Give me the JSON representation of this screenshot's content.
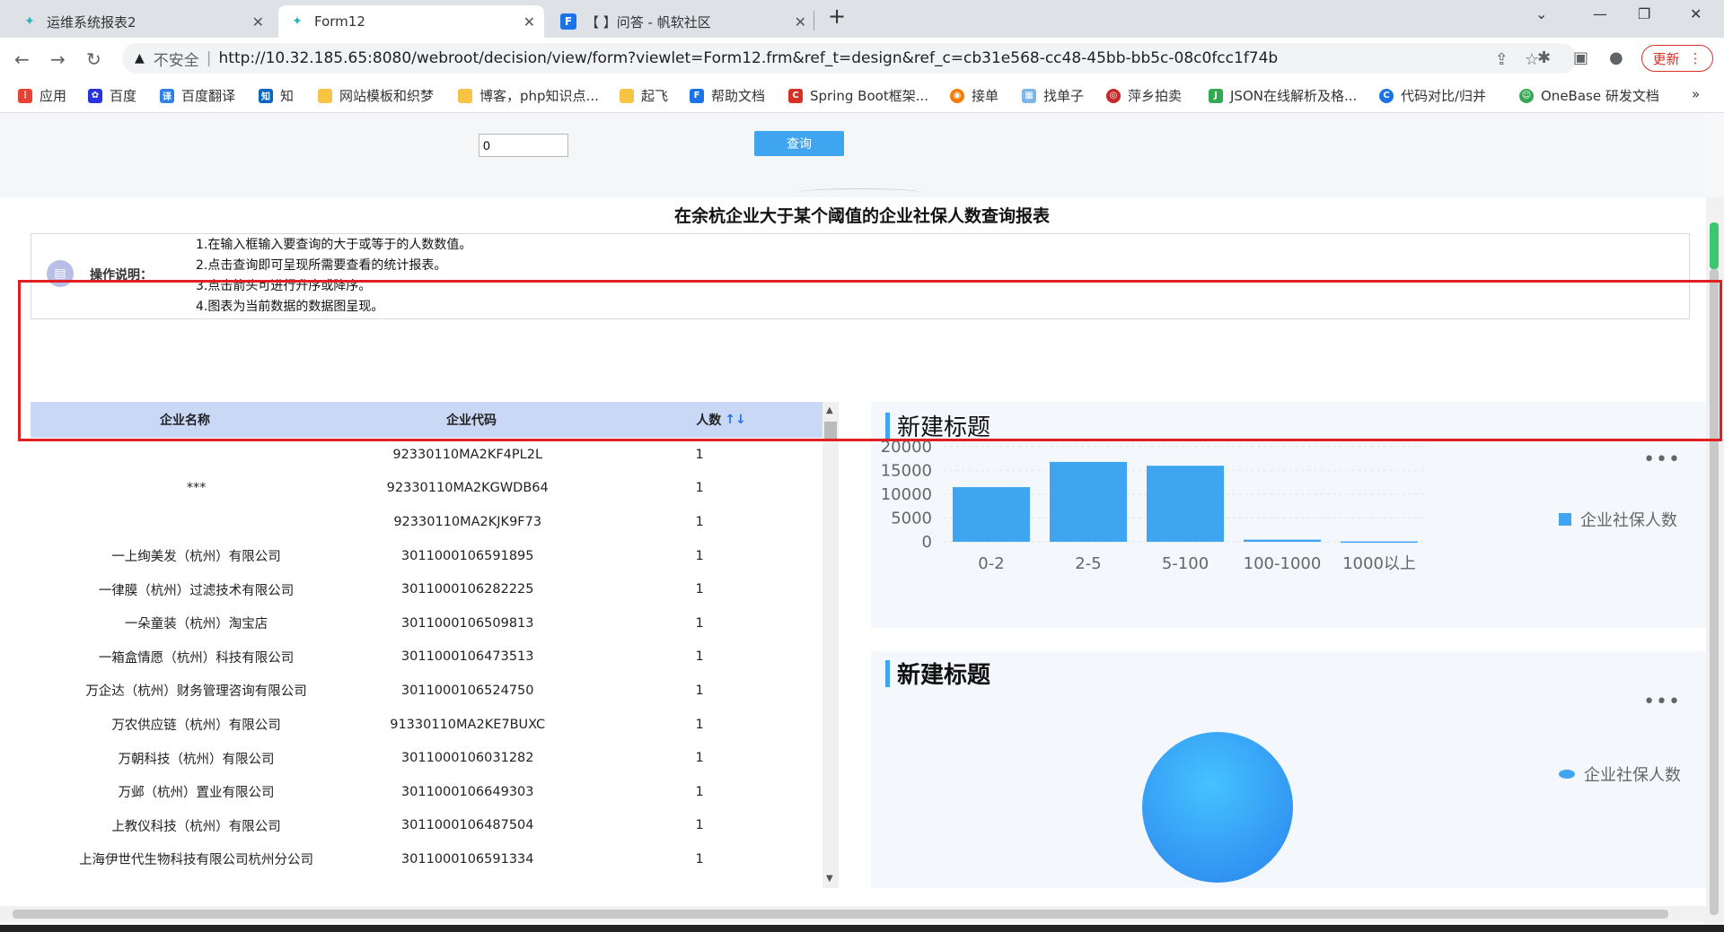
{
  "browser": {
    "tabs": [
      {
        "title": "运维系统报表2",
        "icon": "fanruan-icon"
      },
      {
        "title": "Form12",
        "icon": "fanruan-icon"
      },
      {
        "title": "【              】问答 - 帆软社区",
        "icon": "fanruan-community-icon"
      }
    ],
    "security_label": "不安全",
    "url": "http://10.32.185.65:8080/webroot/decision/view/form?viewlet=Form12.frm&ref_t=design&ref_c=cb31e568-cc48-45bb-bb5c-08c0fcc1f74b",
    "update_label": "更新",
    "bookmarks": [
      "应用",
      "百度",
      "百度翻译",
      "知",
      "网站模板和织梦",
      "博客，php知识点...",
      "起飞",
      "帮助文档",
      "Spring Boot框架...",
      "接单",
      "找单子",
      "萍乡拍卖",
      "JSON在线解析及格...",
      "代码对比/归并",
      "OneBase 研发文档"
    ]
  },
  "query": {
    "input_value": "0",
    "button_label": "查询"
  },
  "report": {
    "title": "在余杭企业大于某个阈值的企业社保人数查询报表",
    "note_label": "操作说明：",
    "notes": [
      "1.在输入框输入要查询的大于或等于的人数数值。",
      "2.点击查询即可呈现所需要查看的统计报表。",
      "3.点击箭头可进行升序或降序。",
      "4.图表为当前数据的数据图呈现。"
    ]
  },
  "table": {
    "headers": [
      "企业名称",
      "企业代码",
      "人数"
    ],
    "sort_icon": "↑↓",
    "rows": [
      [
        "",
        "92330110MA2KF4PL2L",
        "1"
      ],
      [
        "***",
        "92330110MA2KGWDB64",
        "1"
      ],
      [
        "",
        "92330110MA2KJK9F73",
        "1"
      ],
      [
        "一上绚美发（杭州）有限公司",
        "3011000106591895",
        "1"
      ],
      [
        "一律膜（杭州）过滤技术有限公司",
        "3011000106282225",
        "1"
      ],
      [
        "一朵童装（杭州）淘宝店",
        "3011000106509813",
        "1"
      ],
      [
        "一箱盒情愿（杭州）科技有限公司",
        "3011000106473513",
        "1"
      ],
      [
        "万企达（杭州）财务管理咨询有限公司",
        "3011000106524750",
        "1"
      ],
      [
        "万农供应链（杭州）有限公司",
        "91330110MA2KE7BUXC",
        "1"
      ],
      [
        "万朝科技（杭州）有限公司",
        "3011000106031282",
        "1"
      ],
      [
        "万邺（杭州）置业有限公司",
        "3011000106649303",
        "1"
      ],
      [
        "上教仪科技（杭州）有限公司",
        "3011000106487504",
        "1"
      ],
      [
        "上海伊世代生物科技有限公司杭州分公司",
        "3011000106591334",
        "1"
      ]
    ]
  },
  "panels": {
    "bar_title": "新建标题",
    "pie_title": "新建标题",
    "more": "•••",
    "legend": "企业社保人数"
  },
  "colors": {
    "accent": "#3fa5f0",
    "header_bg": "#c9d8f5",
    "highlight": "#e02020"
  },
  "chart_data": [
    {
      "type": "bar",
      "categories": [
        "0-2",
        "2-5",
        "5-100",
        "100-1000",
        "1000以上"
      ],
      "series": [
        {
          "name": "企业社保人数",
          "values": [
            11500,
            16800,
            16000,
            450,
            80
          ]
        }
      ],
      "yticks": [
        0,
        5000,
        10000,
        15000,
        20000
      ],
      "ylim": [
        0,
        20000
      ],
      "legend": "right"
    },
    {
      "type": "pie",
      "series": [
        {
          "name": "企业社保人数",
          "values": [
            1
          ]
        }
      ],
      "legend": "right"
    }
  ]
}
